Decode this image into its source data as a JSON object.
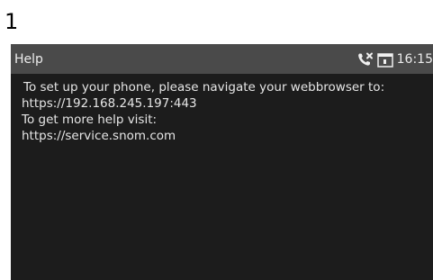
{
  "step_number": "1",
  "screen": {
    "title": "Help",
    "status": {
      "icons": [
        "missed-call-icon",
        "calendar-icon"
      ],
      "time": "16:15"
    },
    "help_lines": [
      "To set up your phone, please navigate your webbrowser to:",
      "https://192.168.245.197:443",
      "To get more help visit:",
      "https://service.snom.com"
    ]
  }
}
